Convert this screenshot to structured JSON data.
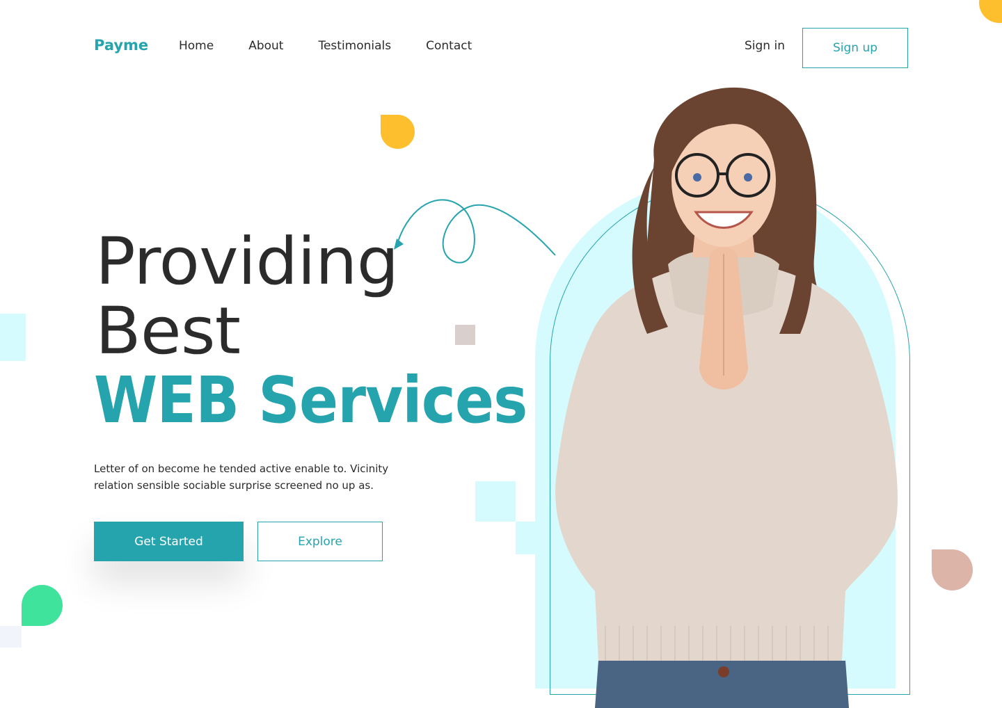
{
  "nav": {
    "logo": "Payme",
    "links": [
      "Home",
      "About",
      "Testimonials",
      "Contact"
    ],
    "signin_label": "Sign in",
    "signup_label": "Sign up"
  },
  "hero": {
    "line1": "Providing",
    "line2": "Best",
    "line3": "WEB Services",
    "description": "Letter of on become he tended active enable to. Vicinity relation sensible sociable surprise screened no up as.",
    "primary_button": "Get Started",
    "secondary_button": "Explore"
  },
  "colors": {
    "brand": "#25a4ae",
    "yellow": "#fdbf2d",
    "cyan_light": "#d5fbff",
    "green": "#3fe39b",
    "pink": "#dcb4a8"
  },
  "icons": [
    "arrow-swirl-icon"
  ]
}
